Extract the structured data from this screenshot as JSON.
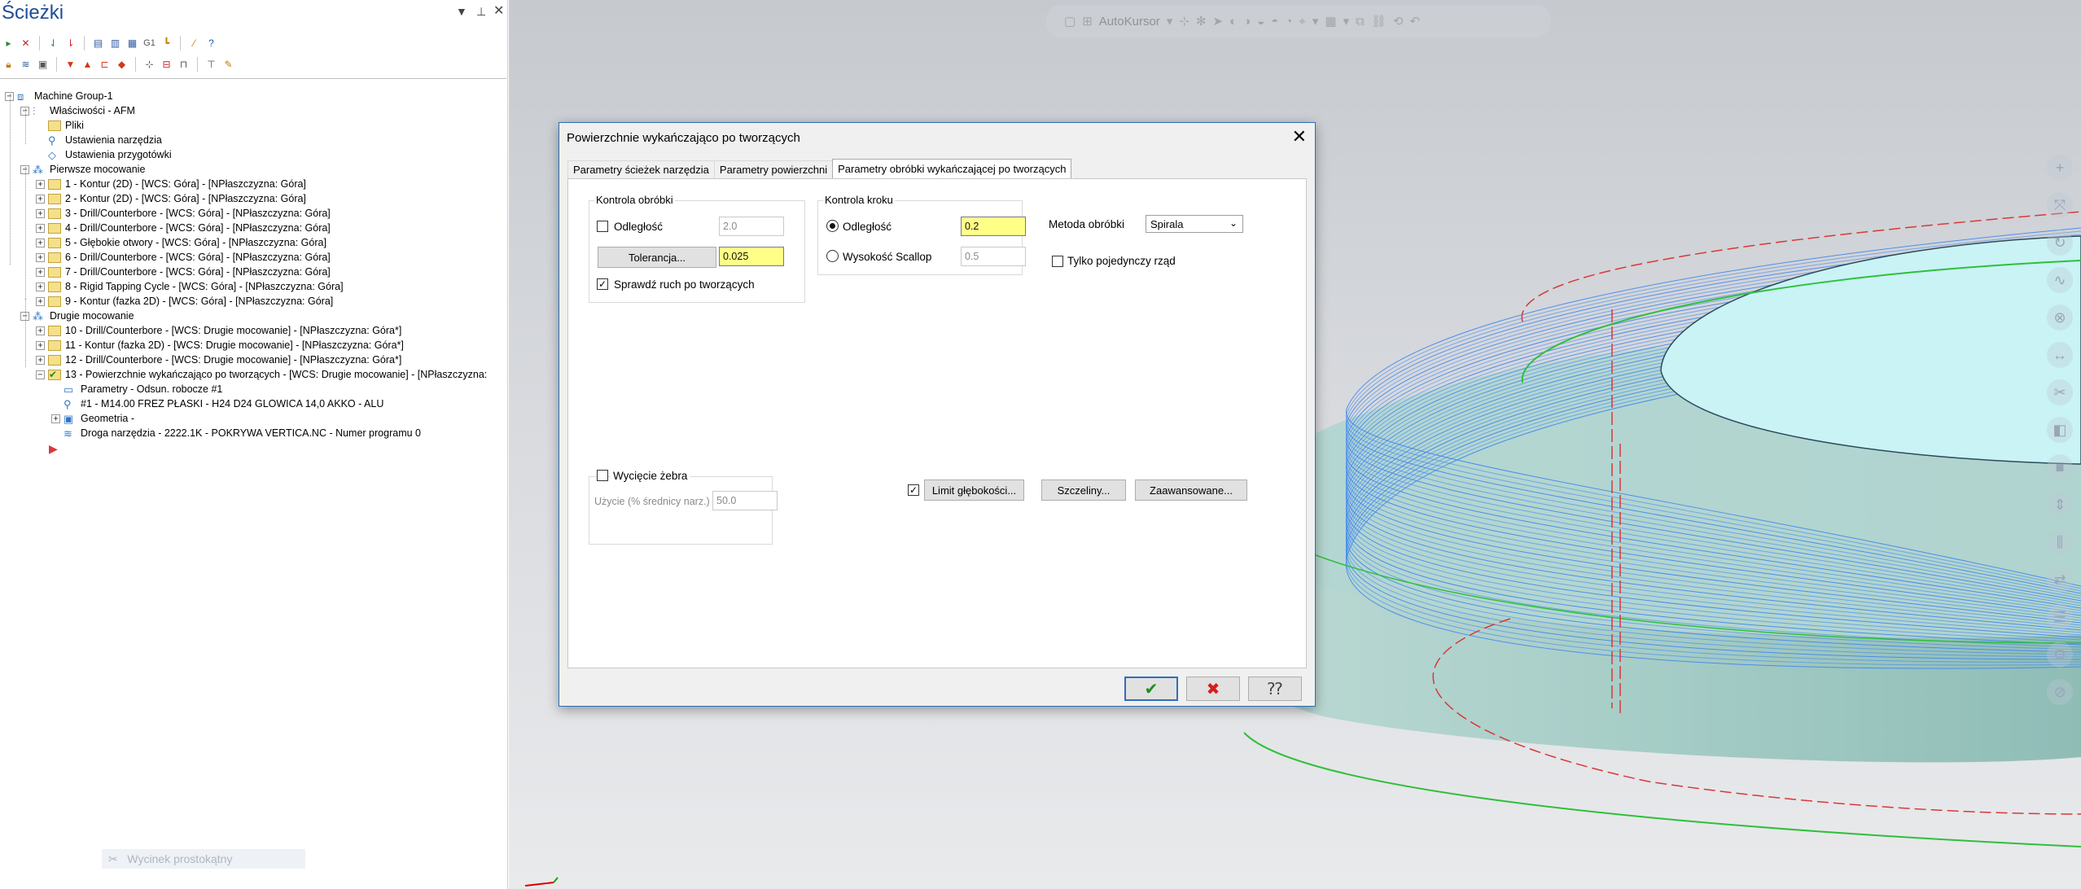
{
  "panel": {
    "title": "Ścieżki",
    "tree": [
      {
        "level": 0,
        "icon": "machine-group-icon",
        "label": "Machine Group-1",
        "exp": "-"
      },
      {
        "level": 1,
        "icon": "properties-icon",
        "label": "Właściwości - AFM",
        "exp": "-"
      },
      {
        "level": 2,
        "icon": "files-icon",
        "label": "Pliki",
        "exp": ""
      },
      {
        "level": 2,
        "icon": "tool-settings-icon",
        "label": "Ustawienia narzędzia",
        "exp": ""
      },
      {
        "level": 2,
        "icon": "stock-settings-icon",
        "label": "Ustawienia przygotówki",
        "exp": ""
      },
      {
        "level": 1,
        "icon": "toolpath-group-icon",
        "label": "Pierwsze mocowanie",
        "exp": "-"
      },
      {
        "level": 2,
        "icon": "folder-icon",
        "label": "1 - Kontur (2D) - [WCS: Góra] - [NPłaszczyzna: Góra]",
        "exp": "+"
      },
      {
        "level": 2,
        "icon": "folder-icon",
        "label": "2 - Kontur (2D) - [WCS: Góra] - [NPłaszczyzna: Góra]",
        "exp": "+"
      },
      {
        "level": 2,
        "icon": "folder-icon",
        "label": "3 - Drill/Counterbore - [WCS: Góra] - [NPłaszczyzna: Góra]",
        "exp": "+"
      },
      {
        "level": 2,
        "icon": "folder-icon",
        "label": "4 - Drill/Counterbore - [WCS: Góra] - [NPłaszczyzna: Góra]",
        "exp": "+"
      },
      {
        "level": 2,
        "icon": "folder-icon",
        "label": "5 - Głębokie otwory - [WCS: Góra] - [NPłaszczyzna: Góra]",
        "exp": "+"
      },
      {
        "level": 2,
        "icon": "folder-icon",
        "label": "6 - Drill/Counterbore - [WCS: Góra] - [NPłaszczyzna: Góra]",
        "exp": "+"
      },
      {
        "level": 2,
        "icon": "folder-icon",
        "label": "7 - Drill/Counterbore - [WCS: Góra] - [NPłaszczyzna: Góra]",
        "exp": "+"
      },
      {
        "level": 2,
        "icon": "folder-icon",
        "label": "8 - Rigid Tapping Cycle - [WCS: Góra] - [NPłaszczyzna: Góra]",
        "exp": "+"
      },
      {
        "level": 2,
        "icon": "folder-icon",
        "label": "9 - Kontur (fazka 2D) - [WCS: Góra] - [NPłaszczyzna: Góra]",
        "exp": "+"
      },
      {
        "level": 1,
        "icon": "toolpath-group-icon",
        "label": "Drugie mocowanie",
        "exp": "-"
      },
      {
        "level": 2,
        "icon": "folder-icon",
        "label": "10 - Drill/Counterbore - [WCS: Drugie mocowanie] - [NPłaszczyzna: Góra*]",
        "exp": "+"
      },
      {
        "level": 2,
        "icon": "folder-icon",
        "label": "11 - Kontur (fazka 2D) - [WCS: Drugie mocowanie] - [NPłaszczyzna: Góra*]",
        "exp": "+"
      },
      {
        "level": 2,
        "icon": "folder-icon",
        "label": "12 - Drill/Counterbore - [WCS: Drugie mocowanie] - [NPłaszczyzna: Góra*]",
        "exp": "+"
      },
      {
        "level": 2,
        "icon": "folder-check-icon",
        "label": "13 - Powierzchnie wykańczająco po tworzących - [WCS: Drugie mocowanie] - [NPłaszczyzna:",
        "exp": "-"
      },
      {
        "level": 3,
        "icon": "parameters-icon",
        "label": "Parametry - Odsun. robocze #1",
        "exp": ""
      },
      {
        "level": 3,
        "icon": "tool-icon",
        "label": "#1 - M14.00 FREZ PŁASKI - H24 D24 GLOWICA 14,0 AKKO - ALU",
        "exp": ""
      },
      {
        "level": 3,
        "icon": "geometry-icon",
        "label": "Geometria -",
        "exp": "+"
      },
      {
        "level": 3,
        "icon": "toolpath-icon",
        "label": "Droga narzędzia - 2222.1K - POKRYWA VERTICA.NC - Numer programu 0",
        "exp": ""
      }
    ],
    "cut_label": "Wycinek prostokątny"
  },
  "viewport": {
    "autocursor": "AutoKursor",
    "colors": {
      "part_fill": "#a9d0cc",
      "part_top": "#c9f3f5",
      "toolpath": "#3f86ee",
      "edge_green": "#2fbf3b",
      "dash_red": "#d83838"
    }
  },
  "dialog": {
    "title": "Powierzchnie wykańczająco po tworzących",
    "tabs": [
      "Parametry ścieżek narzędzia",
      "Parametry powierzchni",
      "Parametry obróbki wykańczającej po tworzących"
    ],
    "kontrola_obrobki": {
      "title": "Kontrola obróbki",
      "odleglosc_label": "Odległość",
      "odleglosc_value": "2.0",
      "tolerancja_button": "Tolerancja...",
      "tolerancja_value": "0.025",
      "sprawdz_label": "Sprawdź ruch po tworzących"
    },
    "kontrola_kroku": {
      "title": "Kontrola kroku",
      "odleglosc_label": "Odległość",
      "odleglosc_value": "0.2",
      "scallop_label": "Wysokość Scallop",
      "scallop_value": "0.5"
    },
    "metoda": {
      "label": "Metoda obróbki",
      "value": "Spirala"
    },
    "tylko_label": "Tylko pojedynczy rząd",
    "wyciecie": {
      "label": "Wycięcie żebra",
      "uzycie_label": "Użycie (% średnicy narz.)",
      "uzycie_value": "50.0"
    },
    "limit_button": "Limit głębokości...",
    "szczeliny_button": "Szczeliny...",
    "zaawansowane_button": "Zaawansowane..."
  }
}
